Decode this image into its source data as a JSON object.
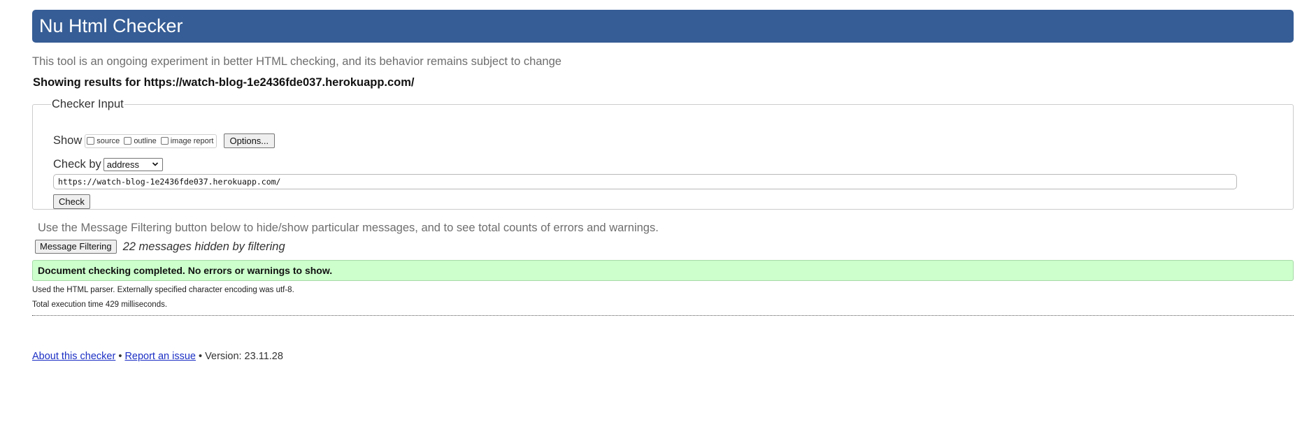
{
  "header": {
    "title": "Nu Html Checker"
  },
  "intro": "This tool is an ongoing experiment in better HTML checking, and its behavior remains subject to change",
  "showing_results": "Showing results for https://watch-blog-1e2436fde037.herokuapp.com/",
  "checker_input": {
    "legend": "Checker Input",
    "show_label": "Show",
    "show_options": [
      {
        "label": "source",
        "checked": false
      },
      {
        "label": "outline",
        "checked": false
      },
      {
        "label": "image report",
        "checked": false
      }
    ],
    "options_button": "Options...",
    "check_by_label": "Check by",
    "check_by_selected": "address",
    "url_value": "https://watch-blog-1e2436fde037.herokuapp.com/",
    "check_button": "Check"
  },
  "filtering": {
    "hint": "Use the Message Filtering button below to hide/show particular messages, and to see total counts of errors and warnings.",
    "button": "Message Filtering",
    "hidden_count": "22 messages hidden by filtering"
  },
  "result": {
    "status": "Document checking completed. No errors or warnings to show.",
    "status_color": "#ccffcc",
    "parser_info": "Used the HTML parser. Externally specified character encoding was utf-8.",
    "execution_time": "Total execution time 429 milliseconds."
  },
  "footer": {
    "about_link": "About this checker",
    "separator": "•",
    "report_link": "Report an issue",
    "version": "Version: 23.11.28"
  },
  "colors": {
    "header_bg": "#365d95",
    "link": "#1b2fc4"
  }
}
